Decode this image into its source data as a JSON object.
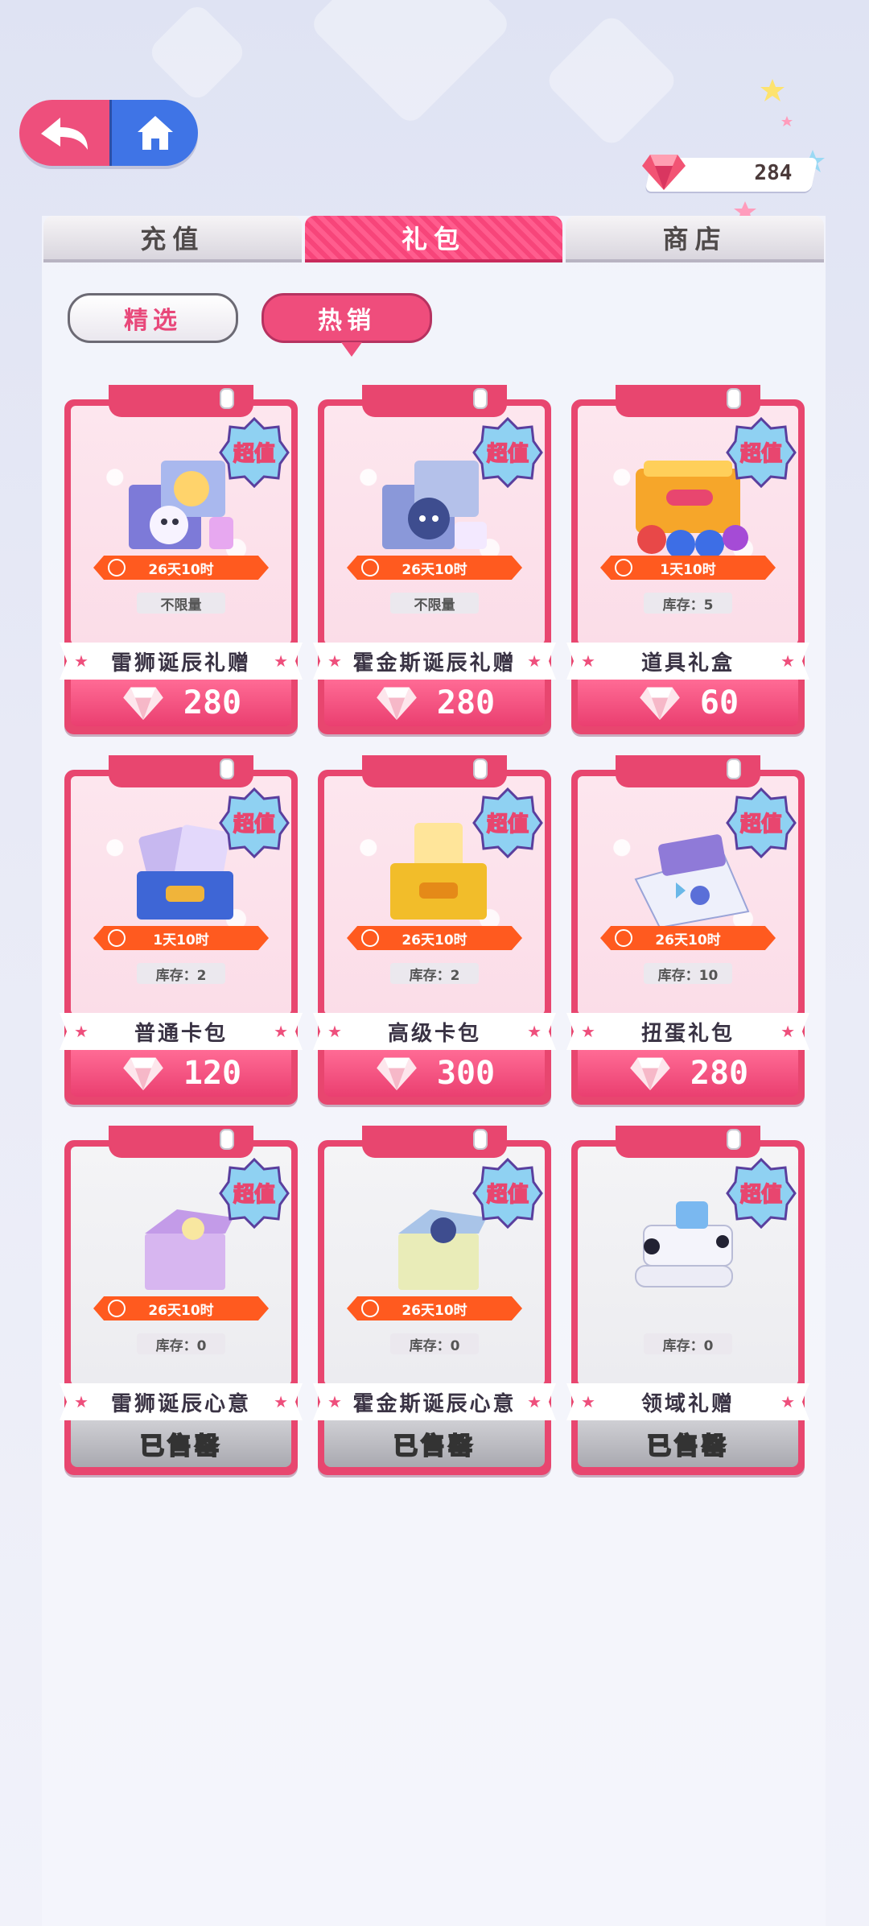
{
  "header": {
    "back_icon": "back-arrow-icon",
    "home_icon": "home-icon",
    "gem_count": "284"
  },
  "tabs": [
    {
      "label": "充值",
      "active": false
    },
    {
      "label": "礼包",
      "active": true
    },
    {
      "label": "商店",
      "active": false
    }
  ],
  "filters": [
    {
      "label": "精选",
      "active": false
    },
    {
      "label": "热销",
      "active": true
    }
  ],
  "badge_label": "超值",
  "items": [
    {
      "name": "雷狮诞辰礼赠",
      "timer": "26天10时",
      "stock": "不限量",
      "price": "280",
      "sold_out": false
    },
    {
      "name": "霍金斯诞辰礼赠",
      "timer": "26天10时",
      "stock": "不限量",
      "price": "280",
      "sold_out": false
    },
    {
      "name": "道具礼盒",
      "timer": "1天10时",
      "stock": "库存：5",
      "price": "60",
      "sold_out": false
    },
    {
      "name": "普通卡包",
      "timer": "1天10时",
      "stock": "库存：2",
      "price": "120",
      "sold_out": false
    },
    {
      "name": "高级卡包",
      "timer": "26天10时",
      "stock": "库存：2",
      "price": "300",
      "sold_out": false
    },
    {
      "name": "扭蛋礼包",
      "timer": "26天10时",
      "stock": "库存：10",
      "price": "280",
      "sold_out": false
    },
    {
      "name": "雷狮诞辰心意",
      "timer": "26天10时",
      "stock": "库存：0",
      "price": "",
      "sold_out": true
    },
    {
      "name": "霍金斯诞辰心意",
      "timer": "26天10时",
      "stock": "库存：0",
      "price": "",
      "sold_out": true
    },
    {
      "name": "领域礼赠",
      "timer": "",
      "stock": "库存：0",
      "price": "",
      "sold_out": true
    }
  ],
  "sold_out_label": "已售罄",
  "colors": {
    "accent_pink": "#ee4f7c",
    "home_blue": "#3f74e6",
    "timer_orange": "#ff5a1f"
  }
}
